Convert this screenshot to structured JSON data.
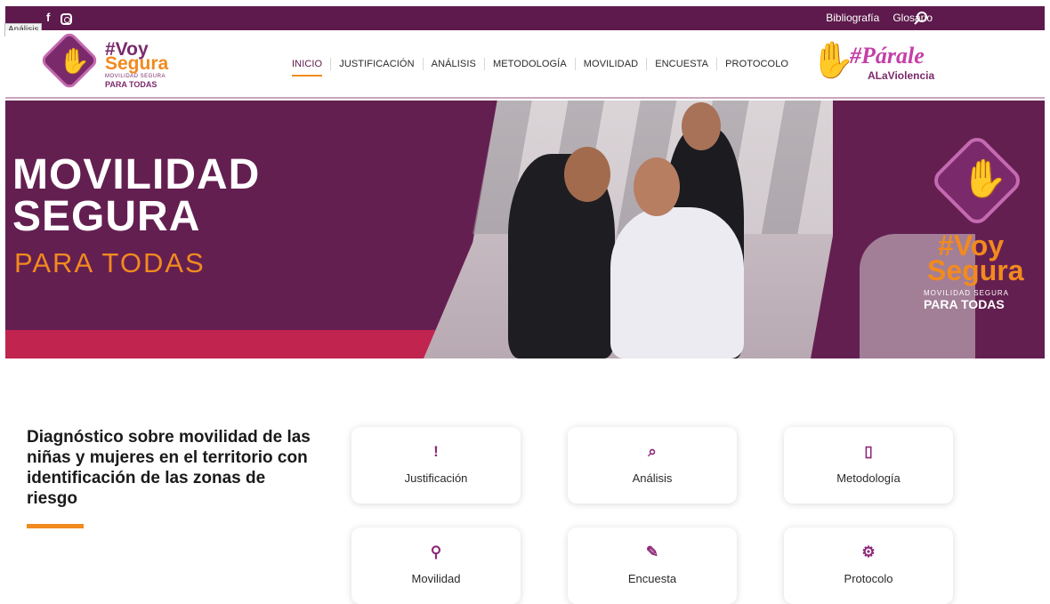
{
  "topbar": {
    "social": [
      "f"
    ],
    "links": [
      "Bibliografía",
      "Glosario"
    ]
  },
  "tooltip": "Análisis",
  "logo": {
    "line1": "#Voy",
    "line2": "Segura",
    "line3": "MOVILIDAD SEGURA",
    "line4": "PARA TODAS"
  },
  "nav": {
    "items": [
      "INICIO",
      "JUSTIFICACIÓN",
      "ANÁLISIS",
      "METODOLOGÍA",
      "MOVILIDAD",
      "ENCUESTA",
      "PROTOCOLO"
    ],
    "active": "INICIO"
  },
  "logo2": {
    "line1": "#Párale",
    "line2": "ALaViolencia"
  },
  "hero": {
    "title_line1": "MOVILIDAD",
    "title_line2": "SEGURA",
    "subtitle": "PARA TODAS",
    "logo_line1": "#Voy",
    "logo_line2": "Segura",
    "logo_line3": "MOVILIDAD SEGURA",
    "logo_line4": "PARA TODAS"
  },
  "intro": {
    "text": "Diagnóstico sobre movilidad de las niñas y mujeres en el territorio con identificación de las zonas de riesgo"
  },
  "cards": [
    {
      "label": "Justificación",
      "icon": "exclamation-icon",
      "glyph": "!"
    },
    {
      "label": "Análisis",
      "icon": "search-icon",
      "glyph": "⌕"
    },
    {
      "label": "Metodología",
      "icon": "clipboard-icon",
      "glyph": "▯"
    },
    {
      "label": "Movilidad",
      "icon": "route-icon",
      "glyph": "⚲"
    },
    {
      "label": "Encuesta",
      "icon": "edit-icon",
      "glyph": "✎"
    },
    {
      "label": "Protocolo",
      "icon": "gear-icon",
      "glyph": "⚙"
    }
  ],
  "colors": {
    "brand_purple": "#5e1a4c",
    "hero_purple": "#641f51",
    "accent_orange": "#f28a1e",
    "accent_red": "#c0244f",
    "icon_purple": "#8e2a7a"
  }
}
